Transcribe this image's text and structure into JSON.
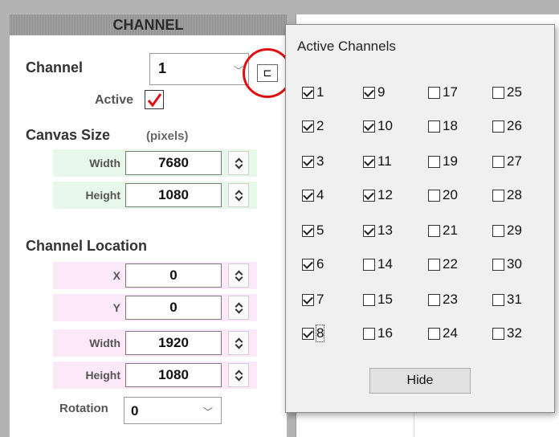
{
  "panel": {
    "header": "CHANNEL",
    "channel_label": "Channel",
    "channel_value": "1",
    "active_label": "Active",
    "active_checked": true,
    "canvas_size_label": "Canvas Size",
    "canvas_size_unit": "(pixels)",
    "canvas_width_label": "Width",
    "canvas_width_value": "7680",
    "canvas_height_label": "Height",
    "canvas_height_value": "1080",
    "location_label": "Channel Location",
    "x_label": "X",
    "x_value": "0",
    "y_label": "Y",
    "y_value": "0",
    "loc_width_label": "Width",
    "loc_width_value": "1920",
    "loc_height_label": "Height",
    "loc_height_value": "1080",
    "rotation_label": "Rotation",
    "rotation_value": "0",
    "channels_button_glyph": "⊏"
  },
  "popup": {
    "title": "Active Channels",
    "hide_label": "Hide",
    "channels": [
      {
        "n": "1",
        "on": true
      },
      {
        "n": "2",
        "on": true
      },
      {
        "n": "3",
        "on": true
      },
      {
        "n": "4",
        "on": true
      },
      {
        "n": "5",
        "on": true
      },
      {
        "n": "6",
        "on": true
      },
      {
        "n": "7",
        "on": true
      },
      {
        "n": "8",
        "on": true
      },
      {
        "n": "9",
        "on": true
      },
      {
        "n": "10",
        "on": true
      },
      {
        "n": "11",
        "on": true
      },
      {
        "n": "12",
        "on": true
      },
      {
        "n": "13",
        "on": true
      },
      {
        "n": "14",
        "on": false
      },
      {
        "n": "15",
        "on": false
      },
      {
        "n": "16",
        "on": false
      },
      {
        "n": "17",
        "on": false
      },
      {
        "n": "18",
        "on": false
      },
      {
        "n": "19",
        "on": false
      },
      {
        "n": "20",
        "on": false
      },
      {
        "n": "21",
        "on": false
      },
      {
        "n": "22",
        "on": false
      },
      {
        "n": "23",
        "on": false
      },
      {
        "n": "24",
        "on": false
      },
      {
        "n": "25",
        "on": false
      },
      {
        "n": "26",
        "on": false
      },
      {
        "n": "27",
        "on": false
      },
      {
        "n": "28",
        "on": false
      },
      {
        "n": "29",
        "on": false
      },
      {
        "n": "30",
        "on": false
      },
      {
        "n": "31",
        "on": false
      },
      {
        "n": "32",
        "on": false
      }
    ]
  },
  "colors": {
    "canvas_tint": "#e8f8e8",
    "location_tint": "#fbe8f8",
    "highlight": "#e01010",
    "check_red": "#e01010"
  }
}
